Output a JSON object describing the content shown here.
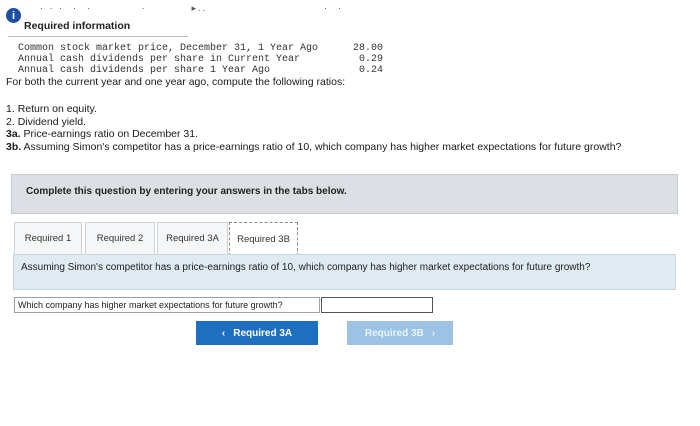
{
  "header": {
    "info_icon": "i",
    "title": "Required information",
    "top_fragment": "· · ·  ·  ·           ·          ▸..                          ·  ·"
  },
  "data_lines": [
    {
      "label": "Common stock market price, December 31, 1 Year Ago",
      "value": "28.00"
    },
    {
      "label": "Annual cash dividends per share in Current Year",
      "value": "0.29"
    },
    {
      "label": "Annual cash dividends per share 1 Year Ago",
      "value": "0.24"
    }
  ],
  "prompt": "For both the current year and one year ago, compute the following ratios:",
  "questions": [
    {
      "num": "1.",
      "text": "Return on equity."
    },
    {
      "num": "2.",
      "text": "Dividend yield."
    },
    {
      "num": "3a.",
      "text": "Price-earnings ratio on December 31."
    },
    {
      "num": "3b.",
      "text": "Assuming Simon's competitor has a price-earnings ratio of 10, which company has higher market expectations for future growth?"
    }
  ],
  "panel_instruction": "Complete this question by entering your answers in the tabs below.",
  "tabs": [
    {
      "label": "Required 1"
    },
    {
      "label": "Required 2"
    },
    {
      "label": "Required 3A"
    },
    {
      "label": "Required 3B"
    }
  ],
  "active_tab": "Required 3B",
  "content": {
    "question": "Assuming Simon's competitor has a price-earnings ratio of 10, which company has higher market expectations for future growth?",
    "answer_label": "Which company has higher market expectations for future growth?",
    "answer_value": ""
  },
  "nav": {
    "prev_label": "Required 3A",
    "prev_icon": "‹",
    "next_label": "Required 3B",
    "next_icon": "›"
  },
  "colors": {
    "info_icon": "#1f4fa3",
    "prev_button": "#1f6fc0",
    "next_button_disabled": "#9cc3e6",
    "panel": "#dcdfe3",
    "content_box": "#dfeaf1"
  }
}
